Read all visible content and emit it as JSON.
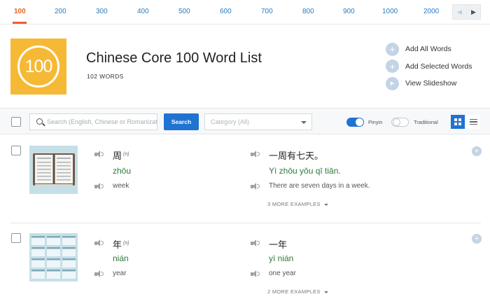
{
  "nav": {
    "levels": [
      "100",
      "200",
      "300",
      "400",
      "500",
      "600",
      "700",
      "800",
      "900",
      "1000",
      "2000"
    ],
    "active": "100",
    "prev_icon": "◀",
    "next_icon": "▶"
  },
  "header": {
    "logo_text": "100",
    "title": "Chinese Core 100 Word List",
    "word_count": "102 WORDS",
    "actions": {
      "add_all": "Add All Words",
      "add_selected": "Add Selected Words",
      "view_slideshow": "View Slideshow"
    }
  },
  "filters": {
    "search_placeholder": "Search (English, Chinese or Romanization)",
    "search_button": "Search",
    "category_value": "Category (All)",
    "pinyin_label": "Pinyin",
    "pinyin_on": true,
    "traditional_label": "Traditional",
    "traditional_on": false,
    "view_mode": "grid"
  },
  "words": [
    {
      "hanzi": "周",
      "pos": "(n)",
      "pinyin": "zhōu",
      "english": "week",
      "example_hanzi": "一周有七天。",
      "example_pinyin": "Yì zhōu yǒu qī tiān.",
      "example_english": "There are seven days in a week.",
      "more_examples": "3 MORE EXAMPLES",
      "image_icon": "calendar-book-icon"
    },
    {
      "hanzi": "年",
      "pos": "(n)",
      "pinyin": "nián",
      "english": "year",
      "example_hanzi": "一年",
      "example_pinyin": "yì nián",
      "example_english": "one year",
      "more_examples": "2 MORE EXAMPLES",
      "image_icon": "year-calendar-icon"
    }
  ],
  "colors": {
    "accent_orange": "#e8632b",
    "logo_yellow": "#f6b936",
    "primary_blue": "#1f73d2",
    "pinyin_green": "#2c7a3a",
    "link_blue": "#2d7bbd"
  }
}
